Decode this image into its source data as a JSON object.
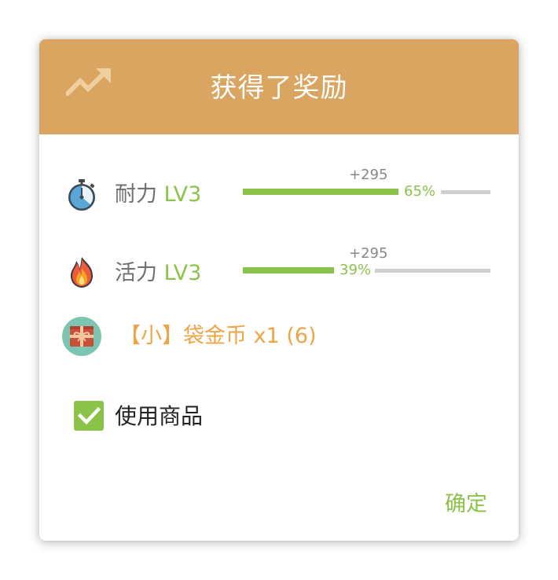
{
  "dialog": {
    "title": "获得了奖励",
    "header_icon": "trending-up-icon",
    "colors": {
      "header": "#d9a560",
      "accent_green": "#8bc34a",
      "reward_orange": "#f0a445",
      "track_gray": "#cfcfcf"
    },
    "stats": [
      {
        "icon": "stopwatch-icon",
        "name": "耐力",
        "level": "LV3",
        "gain": "+295",
        "percent_label": "65%",
        "progress": 0.65
      },
      {
        "icon": "flame-icon",
        "name": "活力",
        "level": "LV3",
        "gain": "+295",
        "percent_label": "39%",
        "progress": 0.39
      }
    ],
    "reward": {
      "icon": "gift-box-icon",
      "text": "【小】袋金币 x1 (6)"
    },
    "use_item": {
      "label": "使用商品",
      "checked": true
    },
    "confirm_label": "确定"
  }
}
